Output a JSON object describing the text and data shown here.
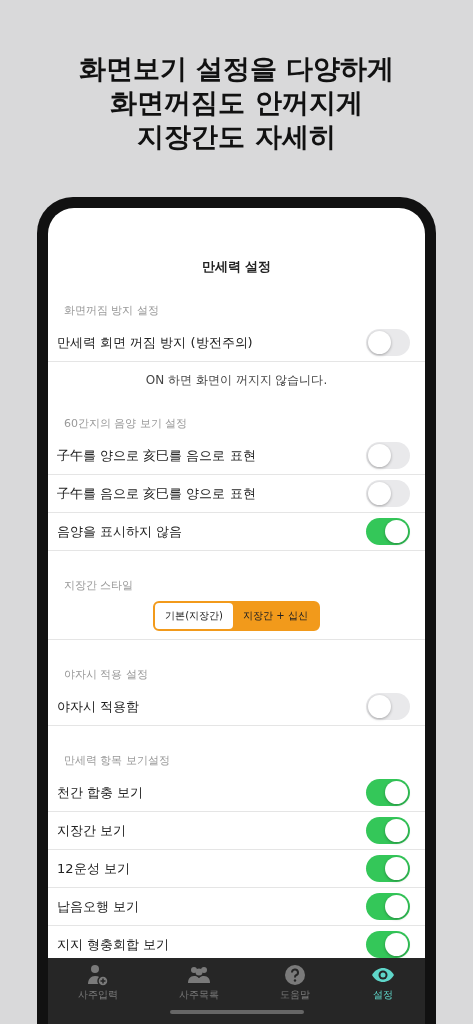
{
  "headline": [
    "화면보기 설정을 다양하게",
    "화면꺼짐도 안꺼지게",
    "지장간도 자세히"
  ],
  "screen": {
    "title": "만세력 설정",
    "sections": [
      {
        "kind": "toggles",
        "header": "화면꺼짐 방지 설정",
        "rows": [
          {
            "label": "만세력 회면 꺼짐 방지 (방전주의)",
            "on": false
          }
        ],
        "note": "ON 하면 화면이 꺼지지 않습니다."
      },
      {
        "kind": "toggles",
        "header": "60간지의 음양 보기 설정",
        "rows": [
          {
            "label": "子午를 양으로 亥巳를 음으로 표현",
            "on": false
          },
          {
            "label": "子午를 음으로 亥巳를 양으로 표현",
            "on": false
          },
          {
            "label": "음양을 표시하지 않음",
            "on": true
          }
        ]
      },
      {
        "kind": "segmented",
        "header": "지장간 스타일",
        "options": [
          {
            "label": "기본(지장간)",
            "selected": false
          },
          {
            "label": "지장간 + 십신",
            "selected": true
          }
        ]
      },
      {
        "kind": "toggles",
        "header": "야자시 적용 설정",
        "rows": [
          {
            "label": "야자시 적용함",
            "on": false
          }
        ]
      },
      {
        "kind": "toggles",
        "header": "만세력 항목 보기설정",
        "rows": [
          {
            "label": "천간 합충 보기",
            "on": true
          },
          {
            "label": "지장간 보기",
            "on": true
          },
          {
            "label": "12운성 보기",
            "on": true
          },
          {
            "label": "납음오행 보기",
            "on": true
          },
          {
            "label": "지지 형충회합 보기",
            "on": true
          }
        ]
      }
    ]
  },
  "tabs": [
    {
      "label": "사주입력",
      "selected": false
    },
    {
      "label": "사주목록",
      "selected": false
    },
    {
      "label": "도움말",
      "selected": false
    },
    {
      "label": "설정",
      "selected": true
    }
  ]
}
